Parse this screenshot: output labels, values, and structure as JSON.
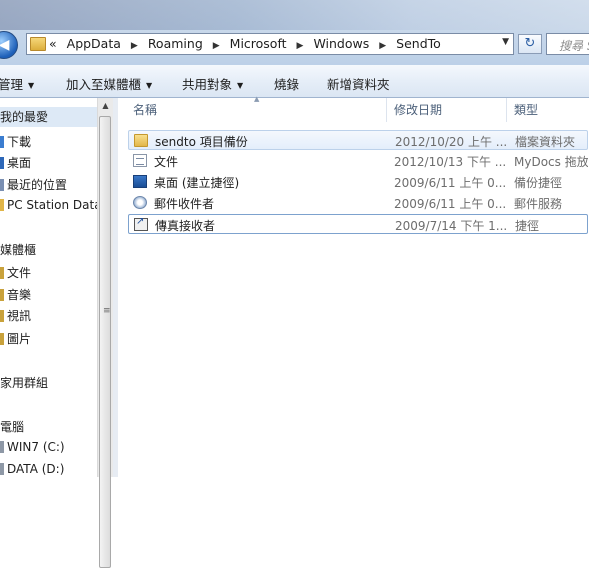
{
  "breadcrumb": {
    "overflow": "«",
    "items": [
      "AppData",
      "Roaming",
      "Microsoft",
      "Windows",
      "SendTo"
    ]
  },
  "search": {
    "placeholder": "搜尋 S"
  },
  "toolbar": {
    "organize": "管理",
    "include_in_library": "加入至媒體櫃",
    "share_with": "共用對象",
    "burn": "燒錄",
    "new_folder": "新增資料夾"
  },
  "nav": {
    "items": [
      {
        "label": "我的最愛",
        "selected": true
      },
      {
        "label": "下載"
      },
      {
        "label": "桌面"
      },
      {
        "label": "最近的位置"
      },
      {
        "label": "PC Station Data"
      },
      {
        "label": "媒體櫃"
      },
      {
        "label": "文件"
      },
      {
        "label": "音樂"
      },
      {
        "label": "視訊"
      },
      {
        "label": "圖片"
      },
      {
        "label": "家用群組"
      },
      {
        "label": "電腦"
      },
      {
        "label": "WIN7 (C:)"
      },
      {
        "label": "DATA (D:)"
      }
    ]
  },
  "columns": {
    "name": "名稱",
    "date": "修改日期",
    "type": "類型"
  },
  "files": [
    {
      "name": "sendto 項目備份",
      "date": "2012/10/20 上午 ...",
      "type": "檔案資料夾",
      "icon": "folder-icon"
    },
    {
      "name": "文件",
      "date": "2012/10/13 下午 ...",
      "type": "MyDocs 拖放...",
      "icon": "document-icon"
    },
    {
      "name": "桌面 (建立捷徑)",
      "date": "2009/6/11 上午 0...",
      "type": "備份捷徑",
      "icon": "desktop-icon"
    },
    {
      "name": "郵件收件者",
      "date": "2009/6/11 上午 0...",
      "type": "郵件服務",
      "icon": "mail-recipient-icon"
    },
    {
      "name": "傳真接收者",
      "date": "2009/7/14 下午 1...",
      "type": "捷徑",
      "icon": "fax-recipient-icon"
    }
  ],
  "colors": {
    "selection": "#dde9f6",
    "toolbar_bg": "#e6eef8",
    "header_text": "#4c607a"
  }
}
